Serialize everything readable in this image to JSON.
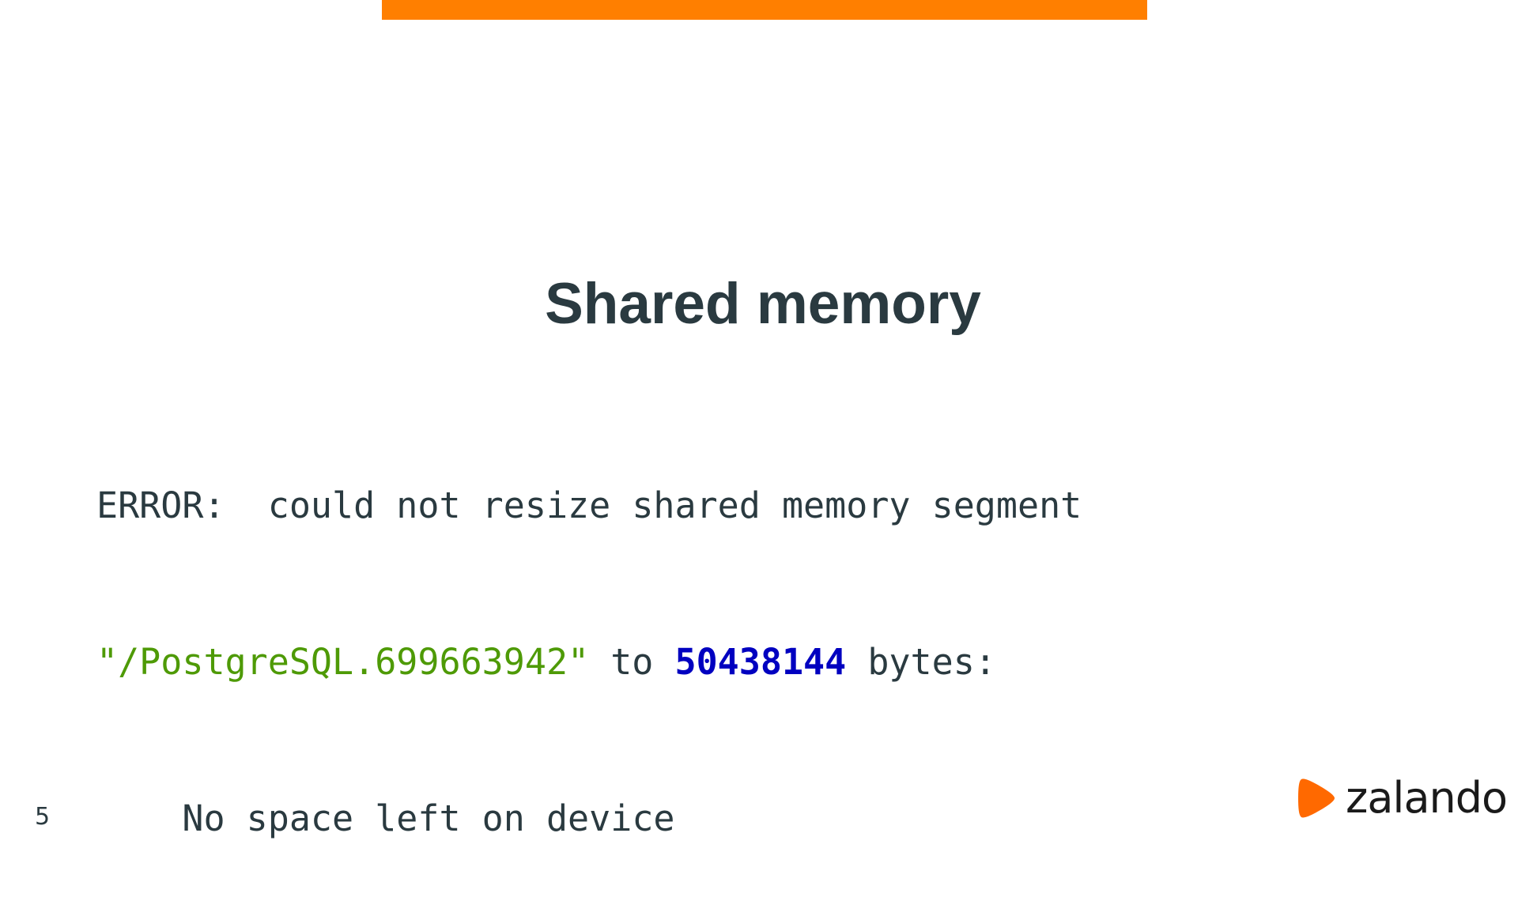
{
  "slide": {
    "title": "Shared memory",
    "page_number": "5",
    "accent_color": "#ff7f00"
  },
  "code": {
    "line1": {
      "keyword": "ERROR:",
      "text": "  could not resize shared memory segment"
    },
    "line2": {
      "string": "\"/PostgreSQL.699663942\"",
      "text1": " to ",
      "number": "50438144",
      "text2": " bytes:"
    },
    "line3": {
      "indent": "    ",
      "text": "No space left on device"
    },
    "colors": {
      "string": "#4e9a06",
      "number": "#0000c0",
      "text": "#2a3a40"
    }
  },
  "logo": {
    "text": "zalando",
    "icon": "zalando-flag-icon",
    "color": "#ff6900"
  }
}
